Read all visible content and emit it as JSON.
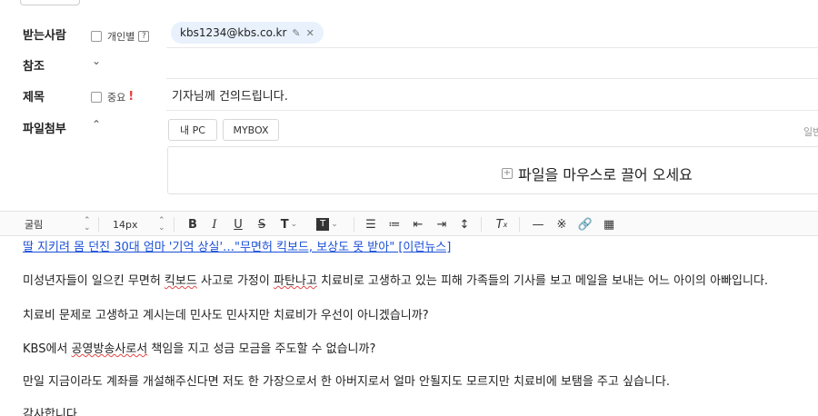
{
  "compose": {
    "to": {
      "label": "받는사람",
      "individual_label": "개인별",
      "help_symbol": "?",
      "recipient_chip": "kbs1234@kbs.co.kr"
    },
    "cc": {
      "label": "참조"
    },
    "subject": {
      "label": "제목",
      "important_label": "중요",
      "important_mark": "!",
      "value": "기자님께 건의드립니다."
    },
    "attachments": {
      "label": "파일첨부",
      "buttons": [
        "내 PC",
        "MYBOX"
      ],
      "dropzone_text": "파일을 마우스로 끌어 오세요",
      "right_cut_text": "일반"
    }
  },
  "toolbar": {
    "font_family": "굴림",
    "font_size": "14px"
  },
  "body": {
    "link_line": "딸 지키려 몸 던진 30대 엄마 '기억 상실'…\"무면허 킥보드, 보상도 못 받아\" [이런뉴스]",
    "paragraph_1_a": "미성년자들이 일으킨 무면허 ",
    "paragraph_1_b": "킥보드",
    "paragraph_1_c": " 사고로 가정이 ",
    "paragraph_1_d": "파탄나고",
    "paragraph_1_e": " 치료비로 고생하고 있는 피해 가족들의 기사를 보고 메일을 보내는 어느 아이의 아빠입니다.",
    "paragraph_2": "치료비 문제로 고생하고 계시는데 민사도 민사지만 치료비가 우선이 아니겠습니까?",
    "paragraph_3_a": "KBS에서 ",
    "paragraph_3_b": "공영방송사로서",
    "paragraph_3_c": " 책임을 지고 성금 모금을 주도할 수 없습니까?",
    "paragraph_4": "만일 지금이라도 계좌를 개설해주신다면 저도 한 가장으로서 한 아버지로서 얼마 안될지도 모르지만 치료비에 보탬을 주고 싶습니다.",
    "paragraph_5": "감사합니다"
  }
}
